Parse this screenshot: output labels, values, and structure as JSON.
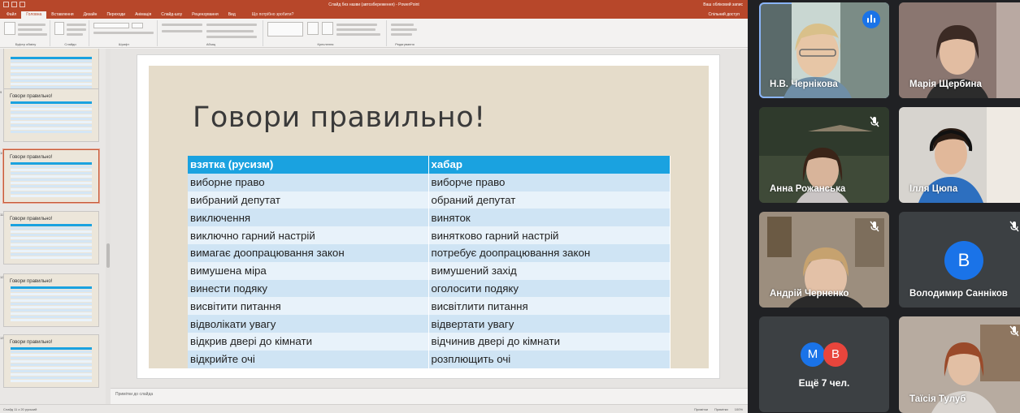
{
  "ppt": {
    "window_title": "Слайд без назви (автозбереження) - PowerPoint",
    "user": "Ваш обліковий запис",
    "tabs": [
      "Файл",
      "Головна",
      "Вставлення",
      "Дизайн",
      "Переходи",
      "Анімація",
      "Слайд-шоу",
      "Рецензування",
      "Вид"
    ],
    "active_tab_index": 1,
    "search_placeholder": "Що потрібно зробити?",
    "share_label": "Спільний доступ",
    "ribbon_groups": [
      "Буфер обміну",
      "Слайди",
      "Шрифт",
      "Абзац",
      "Креслення",
      "Редагування"
    ],
    "notes_placeholder": "Примітки до слайда",
    "status_left": "Слайд 11 з 20   руський",
    "status_right": [
      "Примітки",
      "Примітки",
      "100%"
    ]
  },
  "thumbnails": [
    {
      "num": "8",
      "title": "",
      "rows": 10
    },
    {
      "num": "9",
      "title": "Говори правильно!",
      "rows": 10
    },
    {
      "num": "10",
      "title": "Говори правильно!",
      "rows": 11
    },
    {
      "num": "11",
      "title": "Говори правильно!",
      "rows": 11
    },
    {
      "num": "12",
      "title": "Говори правильно!",
      "rows": 11
    },
    {
      "num": "13",
      "title": "Говори правильно!",
      "rows": 11
    }
  ],
  "slide": {
    "title": "Говори правильно!",
    "table": {
      "headers": [
        "взятка (русизм)",
        "хабар"
      ],
      "rows": [
        [
          "виборне право",
          "виборче право"
        ],
        [
          "вибраний депутат",
          "обраний депутат"
        ],
        [
          "виключення",
          "виняток"
        ],
        [
          "виключно гарний настрій",
          "винятково гарний настрій"
        ],
        [
          "вимагає доопрацювання закон",
          "потребує доопрацювання закон"
        ],
        [
          "вимушена міра",
          "вимушений захід"
        ],
        [
          "винести подяку",
          "оголосити подяку"
        ],
        [
          "висвітити питання",
          "висвітлити питання"
        ],
        [
          "відволікати увагу",
          "відвертати увагу"
        ],
        [
          "відкрив двері до кімнати",
          "відчинив двері до кімнати"
        ],
        [
          "відкрийте очі",
          "розплющить очі"
        ]
      ]
    }
  },
  "meet": {
    "participants": [
      {
        "name": "Н.В. Чернікова",
        "state": "speaking"
      },
      {
        "name": "Марія Щербина",
        "state": "video"
      },
      {
        "name": "Анна Рожанська",
        "state": "muted"
      },
      {
        "name": "Ілля Цюпа",
        "state": "video"
      },
      {
        "name": "Андрій Черненко",
        "state": "muted"
      },
      {
        "name": "Володимир Санніков",
        "state": "muted",
        "avatar_letter": "B"
      },
      {
        "name": "Таїсія Тулуб",
        "state": "muted"
      }
    ],
    "more": {
      "label": "Ещё 7 чел.",
      "avatars": [
        "M",
        "B"
      ]
    },
    "colors": {
      "avatar_blue": "#1a73e8",
      "avatar_orange": "#e8453c",
      "tile_bg": "#3c4043"
    }
  }
}
